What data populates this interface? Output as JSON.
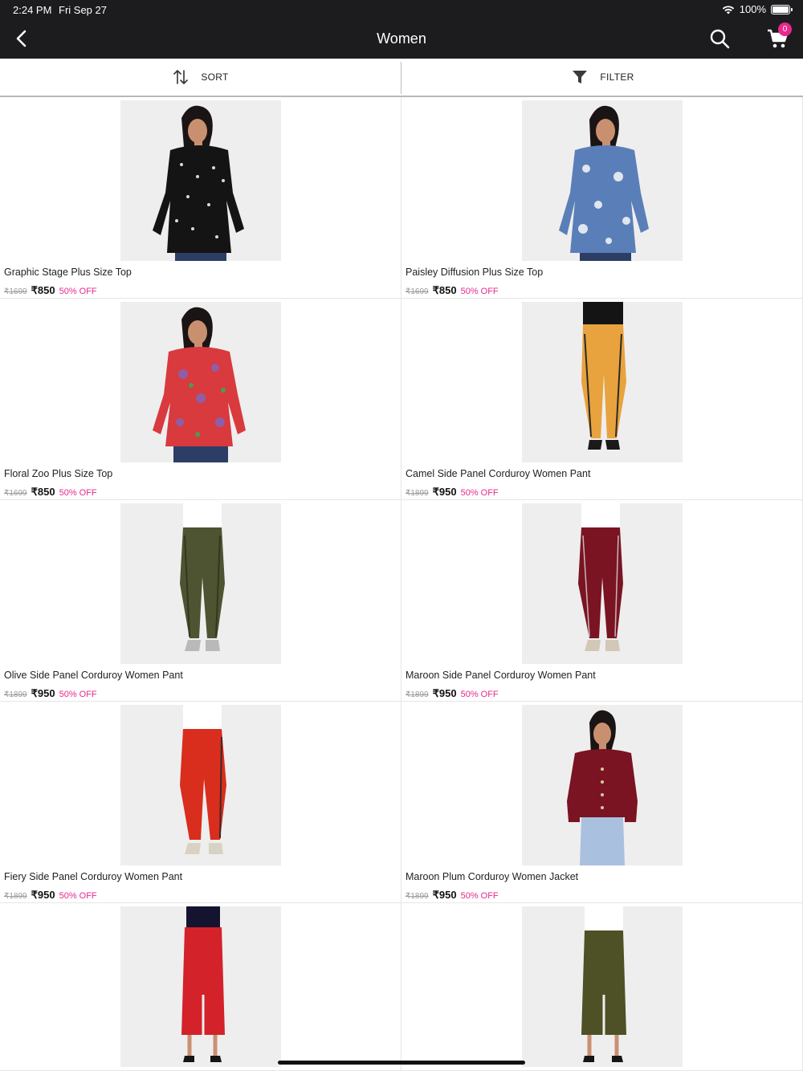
{
  "status_bar": {
    "time": "2:24 PM",
    "date": "Fri Sep 27",
    "battery": "100%"
  },
  "nav": {
    "title": "Women",
    "cart_count": "0"
  },
  "toolbar": {
    "sort_label": "SORT",
    "filter_label": "FILTER"
  },
  "products": [
    {
      "name": "Graphic Stage Plus Size Top",
      "mrp": "₹1699",
      "price": "₹850",
      "discount": "50% OFF"
    },
    {
      "name": "Paisley Diffusion Plus Size Top",
      "mrp": "₹1699",
      "price": "₹850",
      "discount": "50% OFF"
    },
    {
      "name": "Floral Zoo Plus Size Top",
      "mrp": "₹1699",
      "price": "₹850",
      "discount": "50% OFF"
    },
    {
      "name": "Camel Side Panel Corduroy Women Pant",
      "mrp": "₹1899",
      "price": "₹950",
      "discount": "50% OFF"
    },
    {
      "name": "Olive Side Panel Corduroy Women Pant",
      "mrp": "₹1899",
      "price": "₹950",
      "discount": "50% OFF"
    },
    {
      "name": "Maroon Side Panel Corduroy Women Pant",
      "mrp": "₹1899",
      "price": "₹950",
      "discount": "50% OFF"
    },
    {
      "name": "Fiery Side Panel Corduroy Women Pant",
      "mrp": "₹1899",
      "price": "₹950",
      "discount": "50% OFF"
    },
    {
      "name": "Maroon Plum Corduroy Women Jacket",
      "mrp": "₹1899",
      "price": "₹950",
      "discount": "50% OFF"
    },
    {
      "name": "",
      "mrp": "",
      "price": "",
      "discount": ""
    },
    {
      "name": "",
      "mrp": "",
      "price": "",
      "discount": ""
    }
  ],
  "colors": {
    "header_bg": "#1c1c1f",
    "accent_pink": "#e8288c",
    "photo_bg": "#efeeef"
  }
}
